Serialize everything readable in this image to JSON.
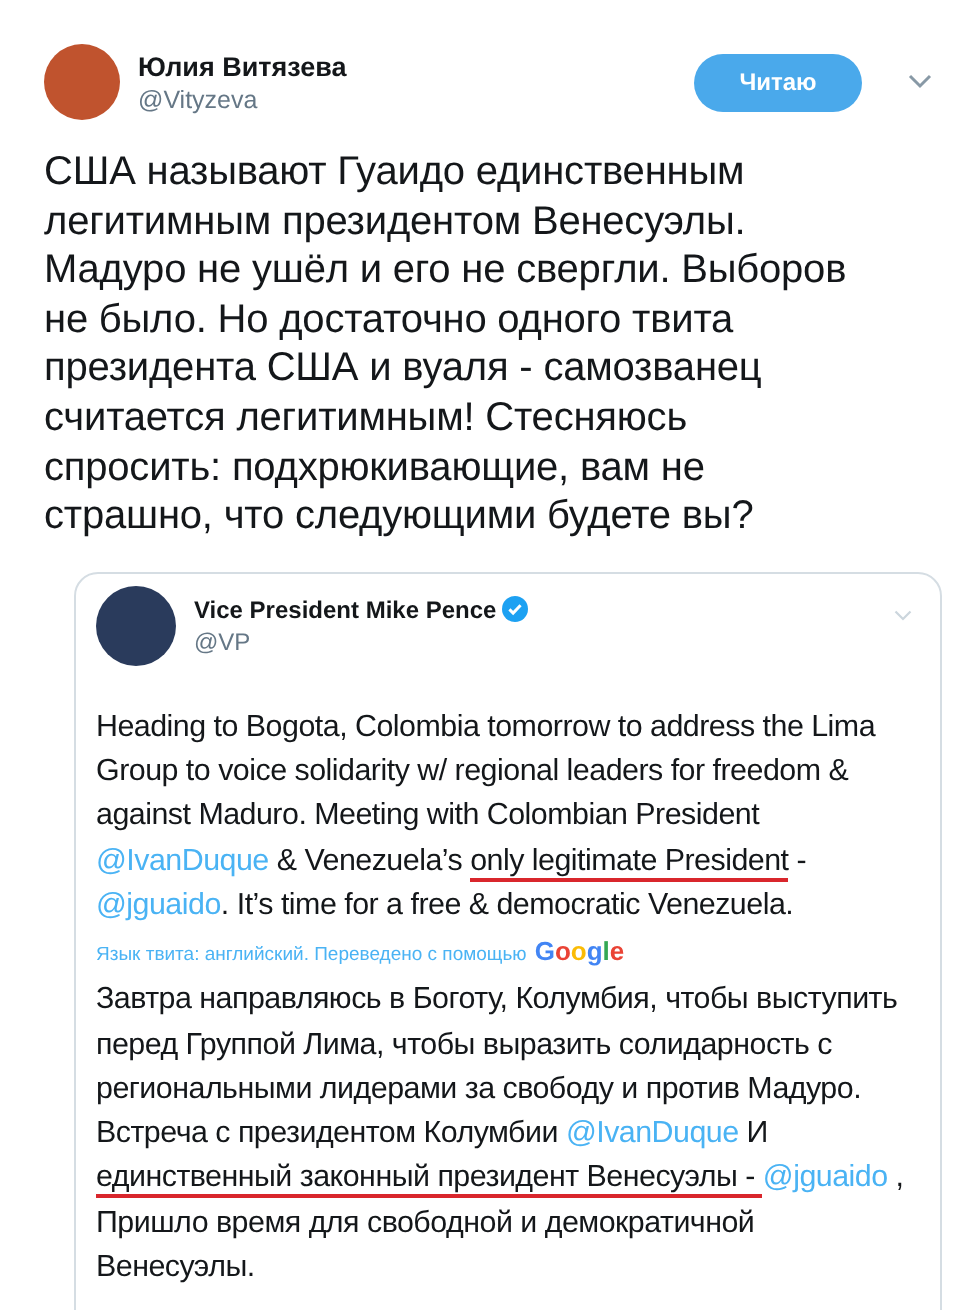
{
  "author": {
    "name": "Юлия Витязева",
    "handle": "@Vityzeva",
    "follow_button": "Читаю"
  },
  "tweet_text": "США называют Гуаидо единственным\nлегитимным президентом Венесуэлы.\nМадуро не ушёл и его не свергли. Выборов\nне было. Но достаточно одного твита\nпрезидента США и вуаля - самозванец\nсчитается легитимным! Стесняюсь\nспросить: подхрюкивающие, вам не\nстрашно, что следующими будете вы?",
  "quoted": {
    "name": "Vice President Mike Pence",
    "verified": true,
    "handle": "@VP",
    "text": [
      {
        "kind": "text",
        "text": "Heading to Bogota, Colombia tomorrow to address the Lima\nGroup to voice solidarity w/ regional leaders for freedom &\nagainst Maduro. Meeting with Colombian President\n"
      },
      {
        "kind": "link",
        "text": "@IvanDuque"
      },
      {
        "kind": "text",
        "text": " & Venezuela’s "
      },
      {
        "kind": "marked",
        "text": "only legitimate President"
      },
      {
        "kind": "text",
        "text": " -\n"
      },
      {
        "kind": "link",
        "text": "@jguaido"
      },
      {
        "kind": "text",
        "text": ". It’s time for a free & democratic Venezuela."
      }
    ],
    "translation_note": "Язык твита: английский. Переведено с помощью",
    "translator": "Google",
    "translation": [
      {
        "kind": "text",
        "text": "Завтра направляюсь в Боготу, Колумбия, чтобы выступить\nперед Группой Лима, чтобы выразить солидарность с\nрегиональными лидерами за свободу и против Мадуро.\nВстреча с президентом Колумбии "
      },
      {
        "kind": "link",
        "text": "@IvanDuque"
      },
      {
        "kind": "text",
        "text": " И\n"
      },
      {
        "kind": "marked",
        "text": "единственный законный президент Венесуэлы - "
      },
      {
        "kind": "link",
        "text": "@jguaido"
      },
      {
        "kind": "text",
        "text": " ,\nПришло время для свободной и демократичной\nВенесуэлы."
      }
    ]
  }
}
